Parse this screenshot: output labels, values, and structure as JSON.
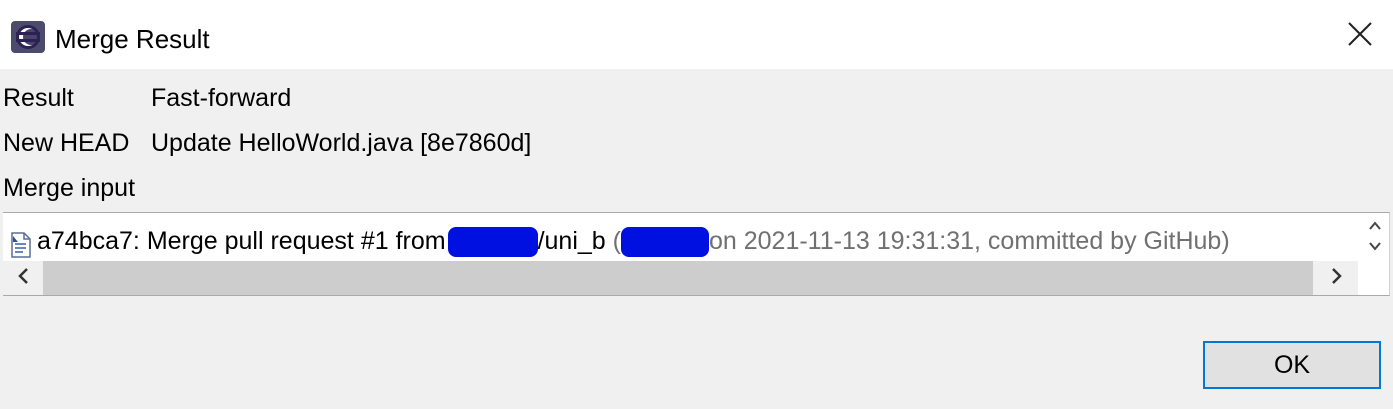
{
  "window": {
    "title": "Merge Result",
    "app_icon": "eclipse-icon",
    "close_icon": "close-icon"
  },
  "fields": {
    "result_label": "Result",
    "result_value": "Fast-forward",
    "new_head_label": "New HEAD",
    "new_head_value": "Update HelloWorld.java [8e7860d]",
    "merge_input_label": "Merge input"
  },
  "merge_input": {
    "commit_icon": "commit-file-icon",
    "commit_prefix": "a74bca7: Merge pull request #1 from",
    "commit_suffix": "/uni_b",
    "meta_open": " (",
    "meta_tail": "on 2021-11-13 19:31:31, committed by GitHub)",
    "redaction_color": "#0010e0"
  },
  "scrollbars": {
    "vertical_icon": "updown-chevron-icon",
    "left_icon": "chevron-left-icon",
    "right_icon": "chevron-right-icon"
  },
  "buttons": {
    "ok_label": "OK"
  },
  "colors": {
    "focus_border": "#0078d7",
    "dialog_background": "#f0f0f0"
  }
}
